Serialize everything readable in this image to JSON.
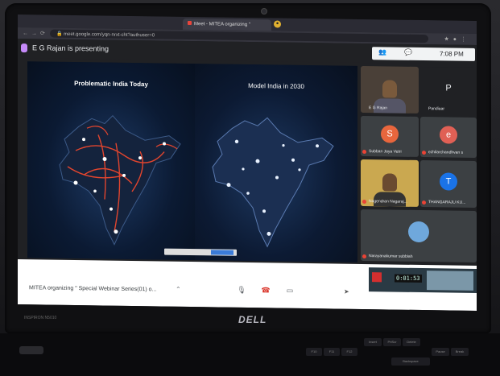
{
  "browser": {
    "tab_title": "Meet - MITEA organizing \"",
    "url": "meet.google.com/yqn-nrxt-cht?authuser=0"
  },
  "meet": {
    "presenter_text": "E G Rajan is presenting",
    "clock": "7:08 PM"
  },
  "slide": {
    "left_title": "Problematic India Today",
    "right_title": "Model India in 2030"
  },
  "participants": [
    {
      "name": "E G Rajan",
      "type": "video"
    },
    {
      "name": "Pandiaar",
      "type": "initial",
      "initial": "P",
      "color": "#202124"
    },
    {
      "name": "Subban Jaya Vetri",
      "type": "initial",
      "initial": "S",
      "color": "#e8663d"
    },
    {
      "name": "ezhilarchandhvan s",
      "type": "initial",
      "initial": "e",
      "color": "#e06055"
    },
    {
      "name": "Nagendran Nagaraj...",
      "type": "video"
    },
    {
      "name": "THANGARAJU KU...",
      "type": "initial",
      "initial": "T",
      "color": "#1a73e8"
    },
    {
      "name": "Narayanakumar subbiah",
      "type": "photo"
    }
  ],
  "bottom": {
    "meeting_title": "MITEA organizing \" Special Webinar Series(01) o...",
    "recorder_time": "0:01:53"
  },
  "laptop": {
    "brand": "DELL",
    "model": "INSPIRON N5010"
  },
  "keys": [
    "Insert",
    "PrtScr",
    "Delete",
    "F10",
    "F11",
    "F12",
    "Backspace",
    "Pause",
    "Break"
  ]
}
